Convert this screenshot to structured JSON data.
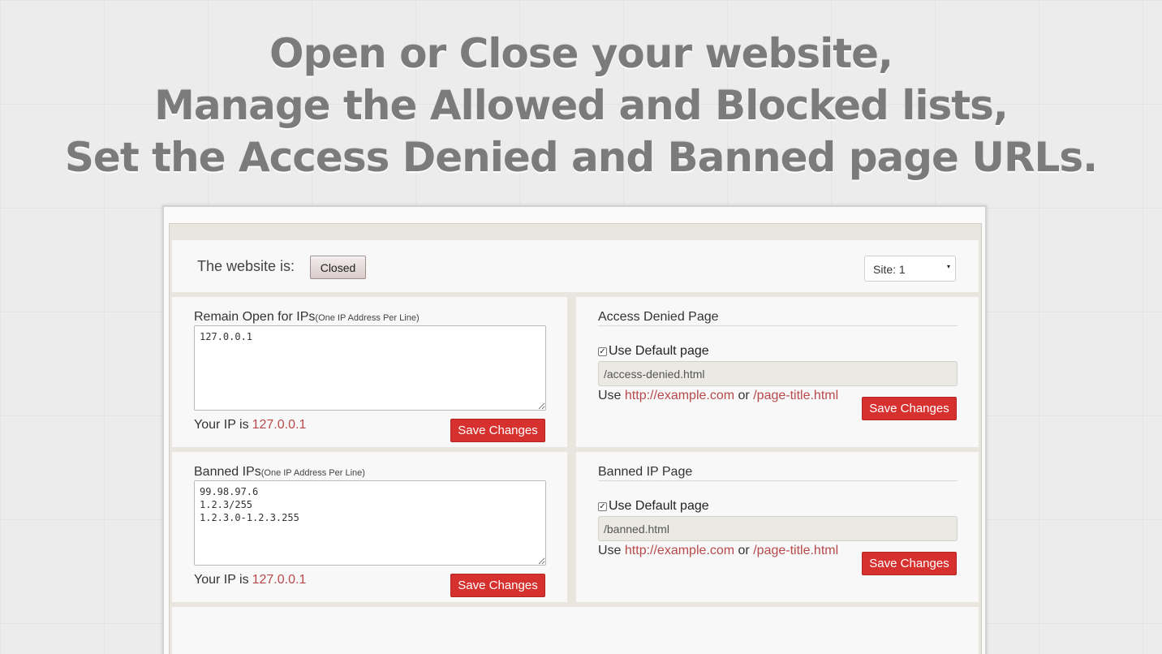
{
  "headline": {
    "line1": "Open or Close your website,",
    "line2": "Manage the Allowed and Blocked lists,",
    "line3": "Set the Access Denied and Banned page URLs."
  },
  "status": {
    "label": "The website is:",
    "button_label": "Closed"
  },
  "site_select": {
    "value": "Site: 1",
    "caret": "▾"
  },
  "open_ips": {
    "title": "Remain Open for IPs",
    "hint": "(One IP Address Per Line)",
    "value": "127.0.0.1",
    "your_ip_label": "Your IP is",
    "your_ip": "127.0.0.1",
    "save_label": "Save Changes"
  },
  "banned_ips": {
    "title": "Banned IPs",
    "hint": "(One IP Address Per Line)",
    "value": "99.98.97.6\n1.2.3/255\n1.2.3.0-1.2.3.255",
    "your_ip_label": "Your IP is",
    "your_ip": "127.0.0.1",
    "save_label": "Save Changes"
  },
  "access_denied": {
    "title": "Access Denied Page",
    "checkbox_label": "Use Default page",
    "checked": true,
    "url": "/access-denied.html",
    "use_label": "Use",
    "example_url": "http://example.com",
    "or_label": "or",
    "example_path": "/page-title.html",
    "save_label": "Save Changes"
  },
  "banned_page": {
    "title": "Banned IP Page",
    "checkbox_label": "Use Default page",
    "checked": true,
    "url": "/banned.html",
    "use_label": "Use",
    "example_url": "http://example.com",
    "or_label": "or",
    "example_path": "/page-title.html",
    "save_label": "Save Changes"
  },
  "colors": {
    "save_button": "#d6302f",
    "link": "#b8494b",
    "headline": "#7b7b7b",
    "panel": "#e8e6df"
  }
}
